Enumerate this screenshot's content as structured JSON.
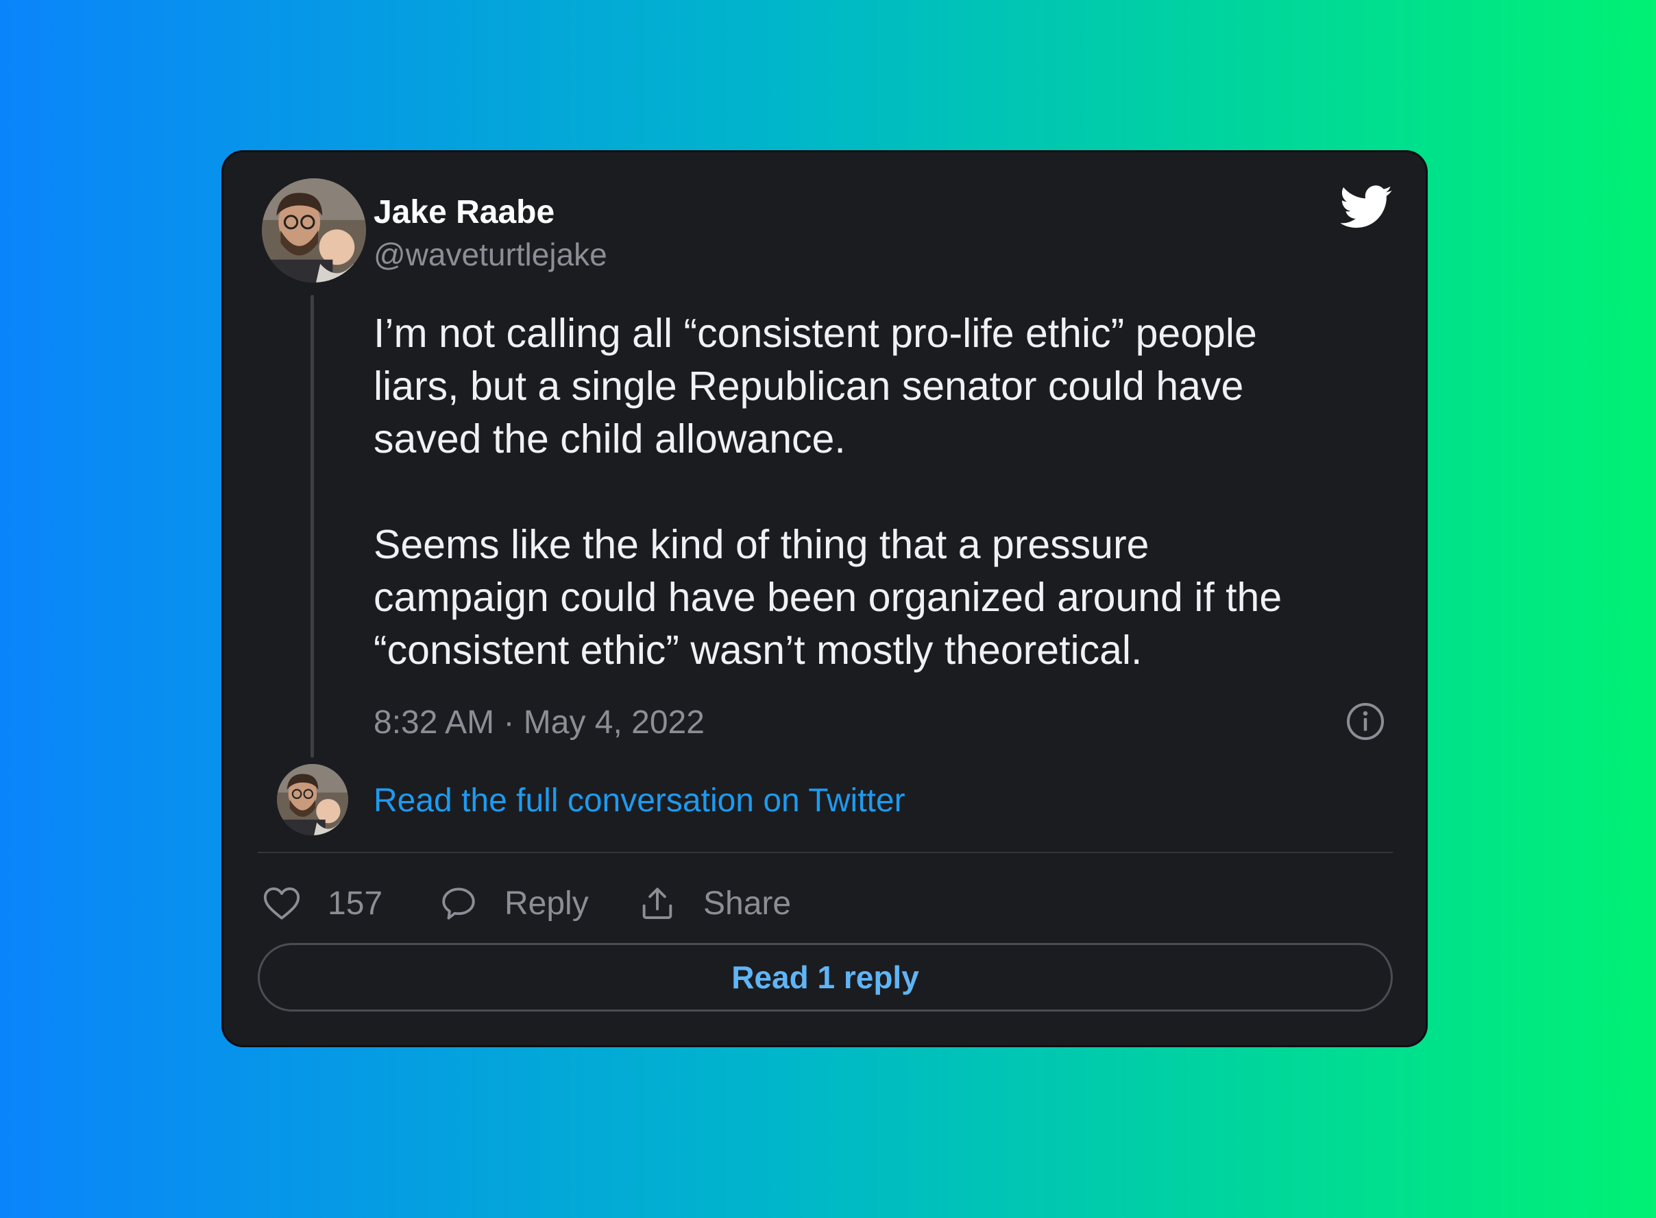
{
  "tweet": {
    "author_name": "Jake Raabe",
    "author_handle": "@waveturtlejake",
    "paragraphs": [
      "I’m not calling all “consistent pro-life ethic” people\nliars, but a single Republican senator could have\nsaved the child allowance.",
      "Seems like the kind of thing that a pressure\ncampaign could have been organized around if the\n“consistent ethic” wasn’t mostly theoretical."
    ],
    "timestamp": "8:32 AM · May 4, 2022",
    "conversation_link": "Read the full conversation on Twitter",
    "likes": "157",
    "reply_label": "Reply",
    "share_label": "Share",
    "read_replies_label": "Read 1 reply"
  },
  "icons": {
    "brand": "twitter-bird-icon",
    "info": "info-icon",
    "like": "heart-icon",
    "reply": "speech-bubble-icon",
    "share": "share-upload-icon"
  },
  "colors": {
    "card_background": "#1b1c20",
    "link": "#1d9bf0",
    "muted_text": "#8b8f95",
    "gradient_start": "#0a84fb",
    "gradient_end": "#00f174"
  }
}
